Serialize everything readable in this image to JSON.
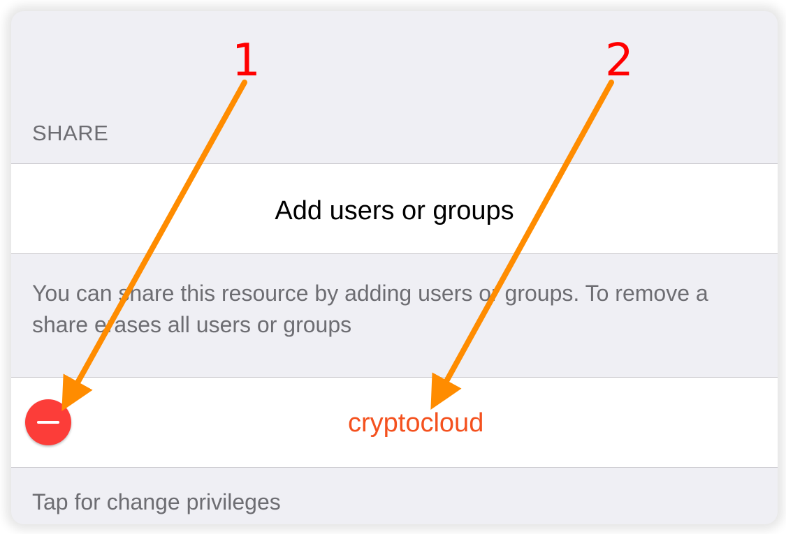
{
  "share_section": {
    "header": "SHARE",
    "add_button_label": "Add users or groups",
    "description": "You can share this resource by adding users or groups. To remove a share erases all users or groups",
    "shares": [
      {
        "name": "cryptocloud"
      }
    ],
    "footer_hint": "Tap for change privileges"
  },
  "annotations": {
    "labels": [
      "1",
      "2"
    ],
    "arrow_color": "#ff8c00",
    "label_color": "#ff0000"
  },
  "colors": {
    "background": "#efeff4",
    "destructive": "#fc3d39",
    "share_text": "#f4511e",
    "secondary_text": "#6d6d72"
  }
}
